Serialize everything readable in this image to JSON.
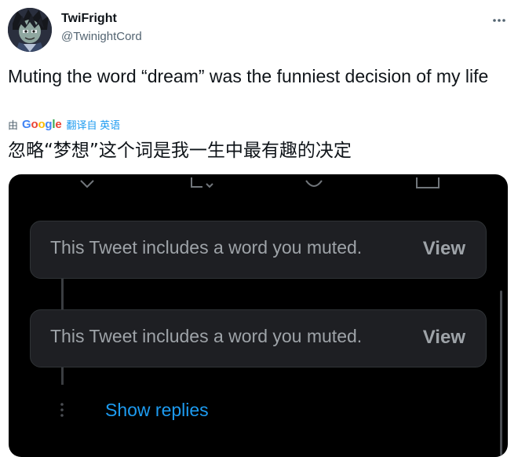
{
  "author": {
    "display_name": "TwiFright",
    "handle": "@TwinightCord"
  },
  "icons": {
    "more": "more-horizontal-icon",
    "avatar": "anime-character-avatar"
  },
  "tweet": {
    "text": "Muting the word “dream” was the funniest decision of my life"
  },
  "translation": {
    "by_label": "由",
    "provider": "Google",
    "link_text": "翻译自 英语",
    "translated_text": "忽略“梦想”这个词是我一生中最有趣的决定"
  },
  "media": {
    "cards": [
      {
        "message": "This Tweet includes a word you muted.",
        "view_label": "View"
      },
      {
        "message": "This Tweet includes a word you muted.",
        "view_label": "View"
      }
    ],
    "show_replies": "Show replies"
  },
  "colors": {
    "link": "#1d9bf0",
    "media_bg": "#000000",
    "card_bg": "#1e1f23"
  }
}
